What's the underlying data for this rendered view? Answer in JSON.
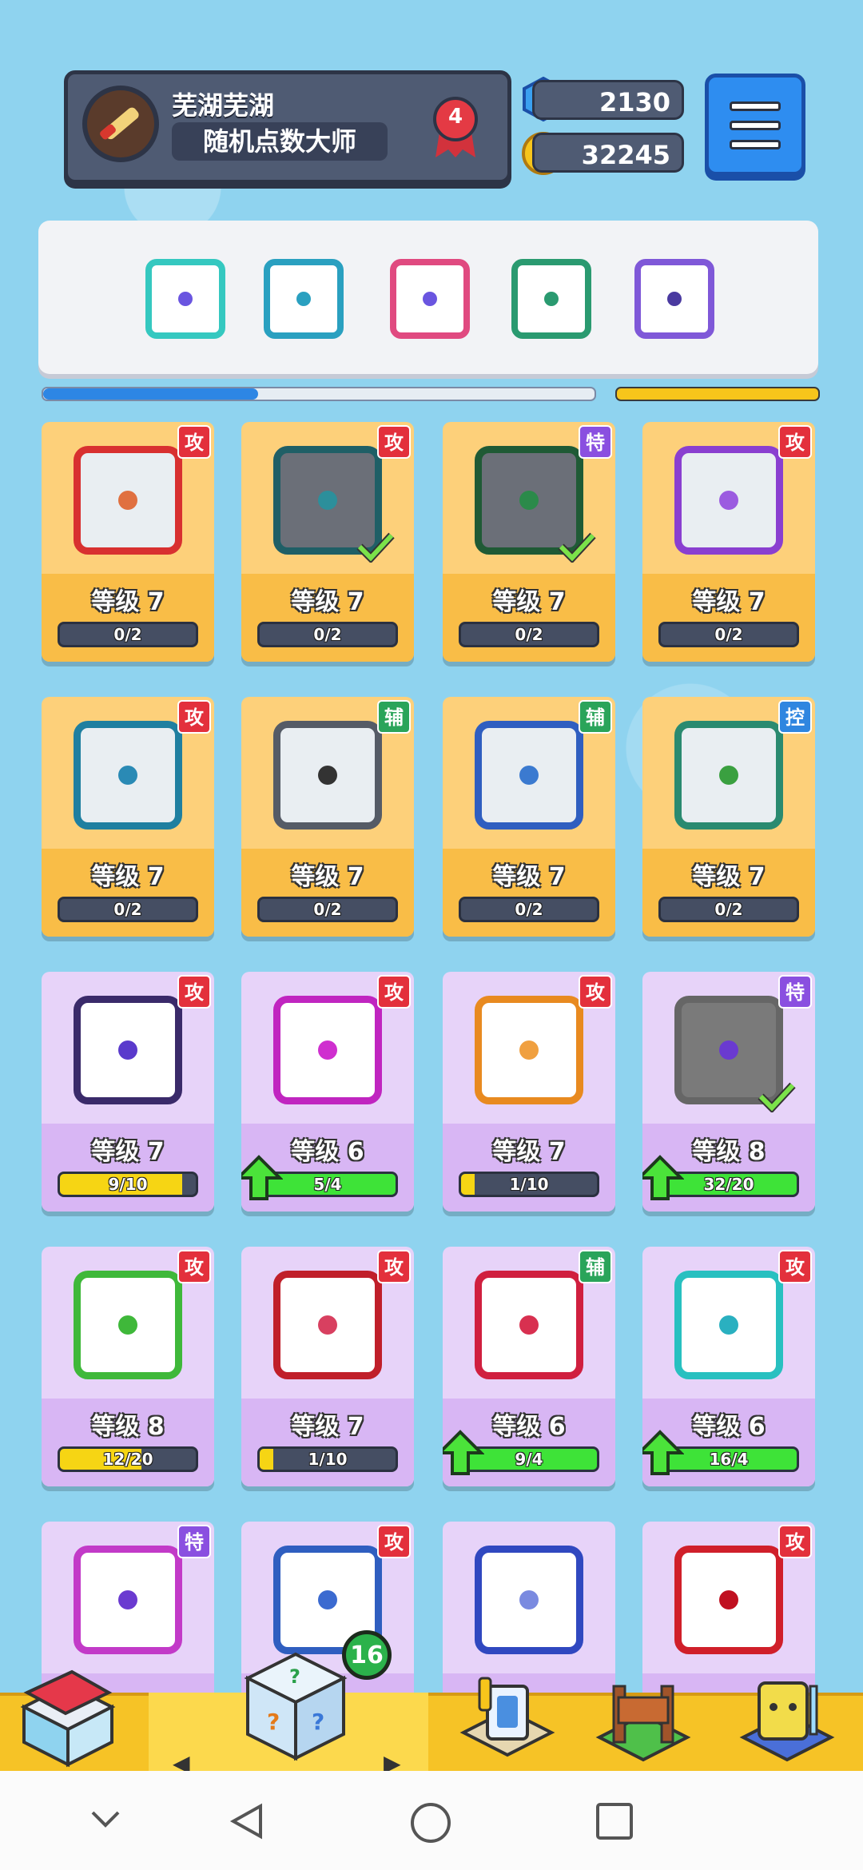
{
  "profile": {
    "name": "芜湖芜湖",
    "title": "随机点数大师",
    "rank": "4"
  },
  "currency": {
    "gems": "2130",
    "coins": "32245"
  },
  "deck": {
    "dice": [
      {
        "color": "#35c8c0",
        "pip": "#6a55e0",
        "icon": "hands-die-icon"
      },
      {
        "color": "#2aa0c0",
        "pip": "#2aa0c0",
        "icon": "dragon-die-icon"
      },
      {
        "color": "#e04a80",
        "pip": "#6a55e0",
        "icon": "rainbow-die-icon"
      },
      {
        "color": "#2a9a70",
        "pip": "#2a9a70",
        "icon": "dragon-green-die-icon"
      },
      {
        "color": "#7f58d8",
        "pip": "#4a3aa0",
        "icon": "crack-die-icon"
      }
    ],
    "progress": 0.39
  },
  "cards": [
    {
      "tier": "legend",
      "tag": "攻",
      "tagType": "atk",
      "level": "等级 7",
      "progress": "0/2",
      "ratio": 0,
      "die": "#d83030",
      "pip": "#e07040",
      "checked": false,
      "upgrade": false
    },
    {
      "tier": "legend",
      "tag": "攻",
      "tagType": "atk",
      "level": "等级 7",
      "progress": "0/2",
      "ratio": 0,
      "die": "#1f5f66",
      "pip": "#2c8f9b",
      "checked": true,
      "upgrade": false
    },
    {
      "tier": "legend",
      "tag": "特",
      "tagType": "spec",
      "level": "等级 7",
      "progress": "0/2",
      "ratio": 0,
      "die": "#1f5a35",
      "pip": "#2b8a4a",
      "checked": true,
      "upgrade": false
    },
    {
      "tier": "legend",
      "tag": "攻",
      "tagType": "atk",
      "level": "等级 7",
      "progress": "0/2",
      "ratio": 0,
      "die": "#8a3fd0",
      "pip": "#9b5be0",
      "checked": false,
      "upgrade": false
    },
    {
      "tier": "legend",
      "tag": "攻",
      "tagType": "atk",
      "level": "等级 7",
      "progress": "0/2",
      "ratio": 0,
      "die": "#1f7fa0",
      "pip": "#2a8ab5",
      "checked": false,
      "upgrade": false
    },
    {
      "tier": "legend",
      "tag": "辅",
      "tagType": "aux",
      "level": "等级 7",
      "progress": "0/2",
      "ratio": 0,
      "die": "#555b66",
      "pip": "#333",
      "checked": false,
      "upgrade": false
    },
    {
      "tier": "legend",
      "tag": "辅",
      "tagType": "aux",
      "level": "等级 7",
      "progress": "0/2",
      "ratio": 0,
      "die": "#2f5ec0",
      "pip": "#3b7ad0",
      "checked": false,
      "upgrade": false
    },
    {
      "tier": "legend",
      "tag": "控",
      "tagType": "ctrl",
      "level": "等级 7",
      "progress": "0/2",
      "ratio": 0,
      "die": "#2a8a70",
      "pip": "#3aa040",
      "checked": false,
      "upgrade": false
    },
    {
      "tier": "epic",
      "tag": "攻",
      "tagType": "atk",
      "level": "等级 7",
      "progress": "9/10",
      "ratio": 0.9,
      "die": "#3a2a6a",
      "pip": "#5a3acc",
      "checked": false,
      "upgrade": false
    },
    {
      "tier": "epic",
      "tag": "攻",
      "tagType": "atk",
      "level": "等级 6",
      "progress": "5/4",
      "ratio": 1,
      "die": "#c025c0",
      "pip": "#cf2fcf",
      "checked": false,
      "upgrade": true
    },
    {
      "tier": "epic",
      "tag": "攻",
      "tagType": "atk",
      "level": "等级 7",
      "progress": "1/10",
      "ratio": 0.1,
      "die": "#e88a20",
      "pip": "#f0a040",
      "checked": false,
      "upgrade": false
    },
    {
      "tier": "epic",
      "tag": "特",
      "tagType": "spec",
      "level": "等级 8",
      "progress": "32/20",
      "ratio": 1,
      "die": "#666",
      "pip": "#6a3ad0",
      "checked": true,
      "upgrade": true
    },
    {
      "tier": "epic",
      "tag": "攻",
      "tagType": "atk",
      "level": "等级 8",
      "progress": "12/20",
      "ratio": 0.6,
      "die": "#3fb83a",
      "pip": "#3fb83a",
      "checked": false,
      "upgrade": false
    },
    {
      "tier": "epic",
      "tag": "攻",
      "tagType": "atk",
      "level": "等级 7",
      "progress": "1/10",
      "ratio": 0.1,
      "die": "#c01f2a",
      "pip": "#d84060",
      "checked": false,
      "upgrade": false
    },
    {
      "tier": "epic",
      "tag": "辅",
      "tagType": "aux",
      "level": "等级 6",
      "progress": "9/4",
      "ratio": 1,
      "die": "#d01f3f",
      "pip": "#d83050",
      "checked": false,
      "upgrade": true
    },
    {
      "tier": "epic",
      "tag": "攻",
      "tagType": "atk",
      "level": "等级 6",
      "progress": "16/4",
      "ratio": 1,
      "die": "#28c0c0",
      "pip": "#2ab0c0",
      "checked": false,
      "upgrade": true
    },
    {
      "tier": "epic",
      "tag": "特",
      "tagType": "spec",
      "level": "",
      "progress": "",
      "ratio": 0,
      "die": "#c23ac8",
      "pip": "#6a3ad0",
      "checked": false,
      "upgrade": false
    },
    {
      "tier": "epic",
      "tag": "攻",
      "tagType": "atk",
      "level": "",
      "progress": "",
      "ratio": 0,
      "die": "#2f5ec0",
      "pip": "#3b6ad0",
      "checked": false,
      "upgrade": false
    },
    {
      "tier": "epic",
      "tag": "",
      "tagType": "",
      "level": "",
      "progress": "",
      "ratio": 0,
      "die": "#3048c0",
      "pip": "#7a8ae0",
      "checked": false,
      "upgrade": false
    },
    {
      "tier": "epic",
      "tag": "攻",
      "tagType": "atk",
      "level": "",
      "progress": "",
      "ratio": 0,
      "die": "#d01f2a",
      "pip": "#c01020",
      "checked": false,
      "upgrade": false
    }
  ],
  "nav": {
    "badge": "16",
    "items": [
      "shop-icon",
      "mystery-box-icon",
      "card-library-icon",
      "events-icon",
      "battle-icon"
    ]
  },
  "colors": {
    "legend": "#fdd07a",
    "epic": "#e7d3f9",
    "accent": "#2e8df0"
  }
}
